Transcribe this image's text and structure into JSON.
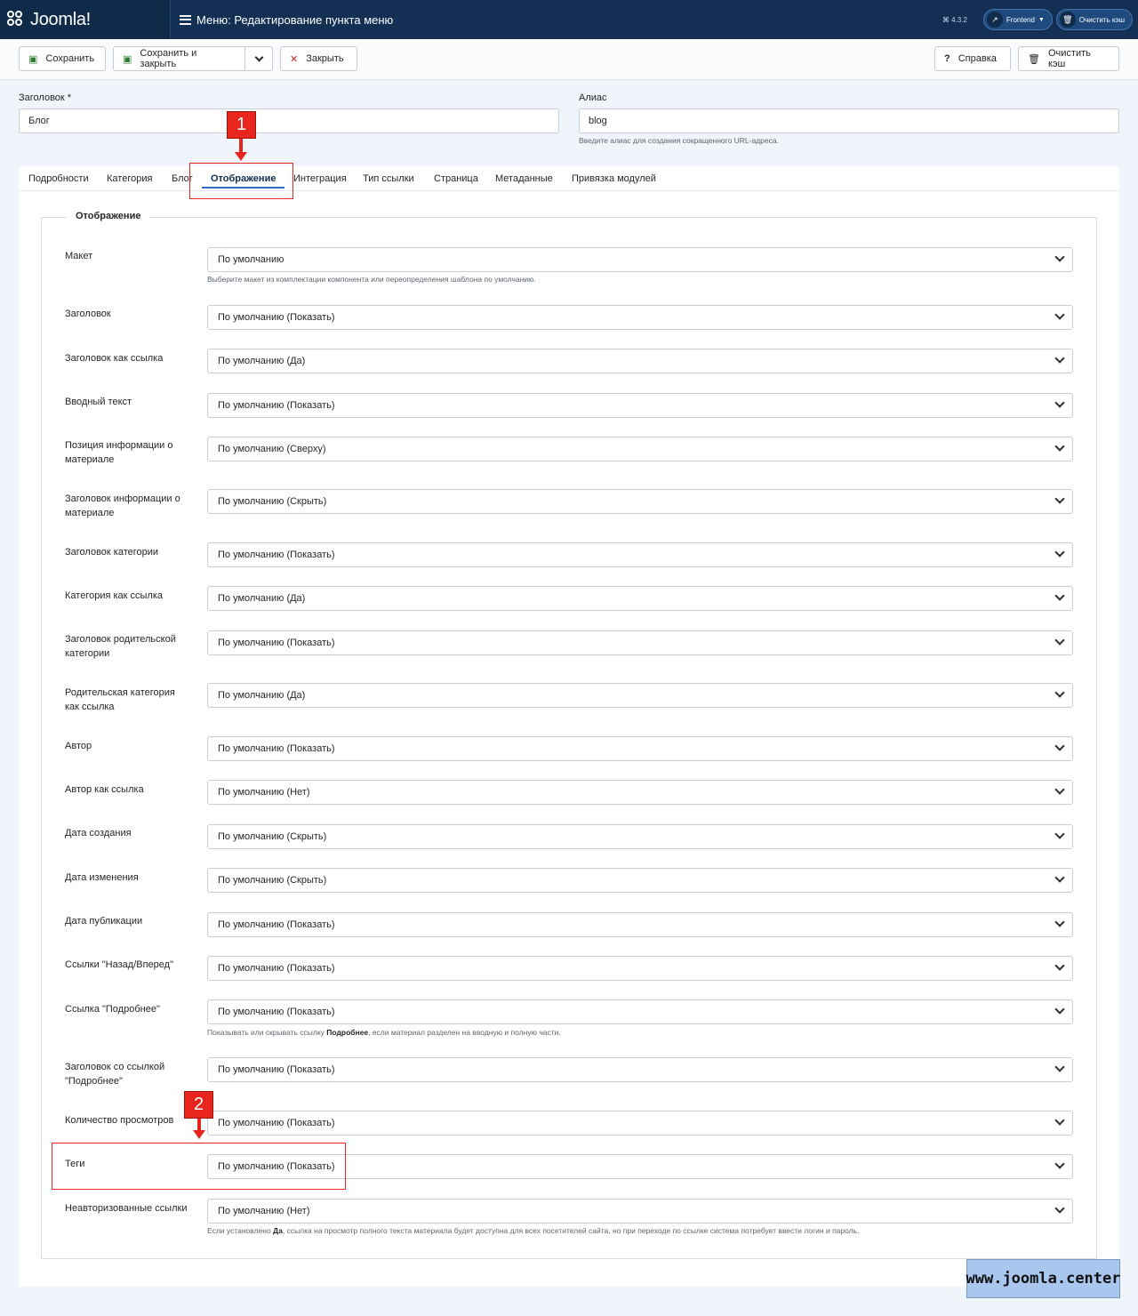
{
  "header": {
    "logo": "Joomla!",
    "title": "Меню: Редактирование пункта меню",
    "version": "⌘ 4.3.2",
    "frontend": "Frontend",
    "clear_cache": "Очистить кэш"
  },
  "toolbar": {
    "save": "Сохранить",
    "save_close": "Сохранить и закрыть",
    "close": "Закрыть",
    "help": "Справка",
    "clear_cache": "Очистить кэш"
  },
  "form": {
    "title_label": "Заголовок *",
    "title_value": "Блог",
    "alias_label": "Алиас",
    "alias_value": "blog",
    "alias_hint": "Введите алиас для создания сокращенного URL-адреса."
  },
  "tabs": [
    "Подробности",
    "Категория",
    "Блог",
    "Отображение",
    "Интеграция",
    "Тип ссылки",
    "Страница",
    "Метаданные",
    "Привязка модулей"
  ],
  "fieldset": {
    "legend": "Отображение",
    "rows": [
      {
        "label": "Макет",
        "value": "По умолчанию",
        "hint": "Выберите макет из комплектации компонента или переопределения шаблона по умолчанию."
      },
      {
        "label": "Заголовок",
        "value": "По умолчанию (Показать)"
      },
      {
        "label": "Заголовок как ссылка",
        "value": "По умолчанию (Да)"
      },
      {
        "label": "Вводный текст",
        "value": "По умолчанию (Показать)"
      },
      {
        "label": "Позиция информации о материале",
        "value": "По умолчанию (Сверху)"
      },
      {
        "label": "Заголовок информации о материале",
        "value": "По умолчанию (Скрыть)"
      },
      {
        "label": "Заголовок категории",
        "value": "По умолчанию (Показать)"
      },
      {
        "label": "Категория как ссылка",
        "value": "По умолчанию (Да)"
      },
      {
        "label": "Заголовок родительской категории",
        "value": "По умолчанию (Показать)"
      },
      {
        "label": "Родительская категория как ссылка",
        "value": "По умолчанию (Да)"
      },
      {
        "label": "Автор",
        "value": "По умолчанию (Показать)"
      },
      {
        "label": "Автор как ссылка",
        "value": "По умолчанию (Нет)"
      },
      {
        "label": "Дата создания",
        "value": "По умолчанию (Скрыть)"
      },
      {
        "label": "Дата изменения",
        "value": "По умолчанию (Скрыть)"
      },
      {
        "label": "Дата публикации",
        "value": "По умолчанию (Показать)"
      },
      {
        "label": "Ссылки \"Назад/Вперед\"",
        "value": "По умолчанию (Показать)"
      },
      {
        "label": "Ссылка \"Подробнее\"",
        "value": "По умолчанию (Показать)",
        "hint_pre": "Показывать или скрывать ссылку ",
        "hint_bold": "Подробнее",
        "hint_post": ", если материал разделен на вводную и полную части."
      },
      {
        "label": "Заголовок со ссылкой \"Подробнее\"",
        "value": "По умолчанию (Показать)"
      },
      {
        "label": "Количество просмотров",
        "value": "По умолчанию (Показать)"
      },
      {
        "label": "Теги",
        "value": "По умолчанию (Показать)"
      },
      {
        "label": "Неавторизованные ссылки",
        "value": "По умолчанию (Нет)",
        "hint_pre": "Если установлено ",
        "hint_bold": "Да",
        "hint_post": ", ссылка на просмотр полного текста материала будет доступна для всех посетителей сайта, но при переходе по ссылке система потребует ввести логин и пароль."
      }
    ]
  },
  "annotations": {
    "badge1": "1",
    "badge2": "2"
  },
  "watermark": "www.joomla.center"
}
